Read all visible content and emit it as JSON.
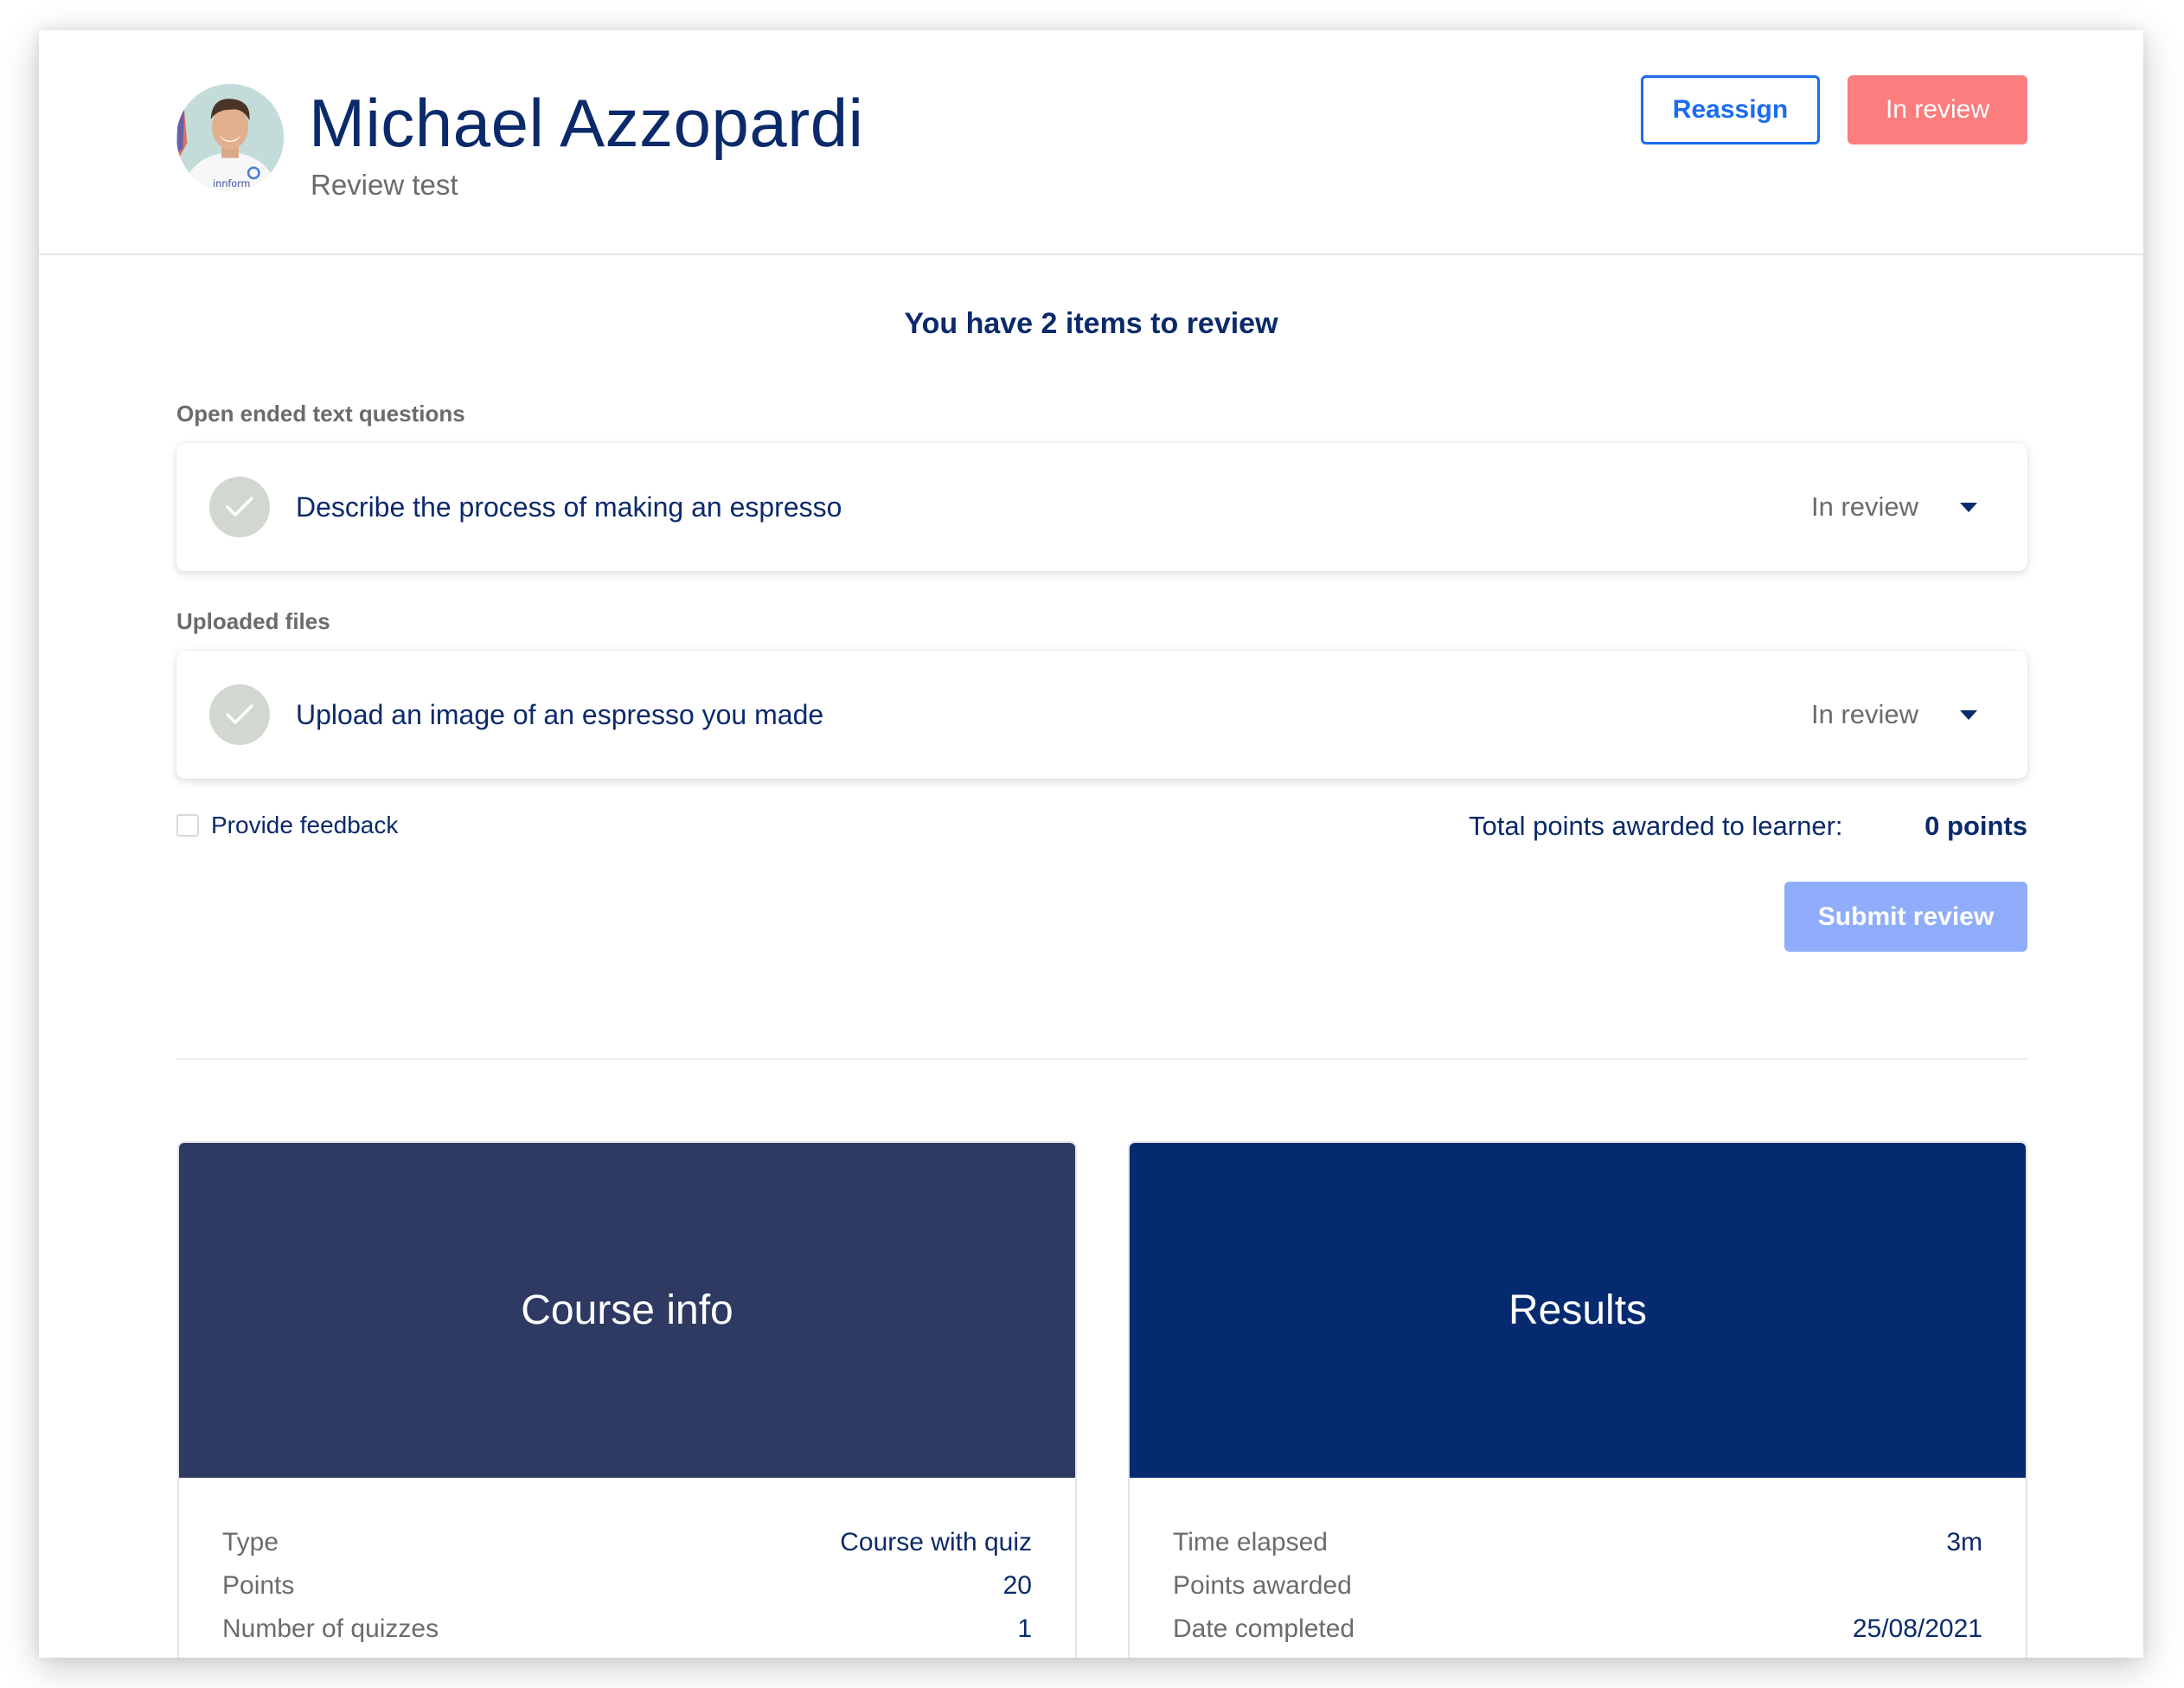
{
  "header": {
    "learner_name": "Michael Azzopardi",
    "subtitle": "Review test",
    "avatar_alt": "Profile photo of Michael Azzopardi",
    "avatar_shirt_text": "innform",
    "reassign_label": "Reassign",
    "status_label": "In review"
  },
  "review": {
    "heading": "You have 2 items to review",
    "sections": [
      {
        "label": "Open ended text questions",
        "item": {
          "title": "Describe the process of making an espresso",
          "status": "In review"
        }
      },
      {
        "label": "Uploaded files",
        "item": {
          "title": "Upload an image of an espresso you made",
          "status": "In review"
        }
      }
    ],
    "feedback_label": "Provide feedback",
    "feedback_checked": false,
    "total_label": "Total points awarded to learner:",
    "total_value": "0 points",
    "submit_label": "Submit review"
  },
  "course_info": {
    "title": "Course info",
    "rows": [
      {
        "label": "Type",
        "value": "Course with quiz"
      },
      {
        "label": "Points",
        "value": "20"
      },
      {
        "label": "Number of quizzes",
        "value": "1"
      }
    ]
  },
  "results": {
    "title": "Results",
    "rows": [
      {
        "label": "Time elapsed",
        "value": "3m"
      },
      {
        "label": "Points awarded",
        "value": ""
      },
      {
        "label": "Date completed",
        "value": "25/08/2021"
      }
    ]
  },
  "colors": {
    "primary_text": "#0b2a6b",
    "accent_blue": "#1a6bf0",
    "status_red": "#fb7d7d",
    "submit_disabled": "#8fadfb",
    "course_banner": "#2e3a62",
    "results_banner": "#052a70"
  }
}
